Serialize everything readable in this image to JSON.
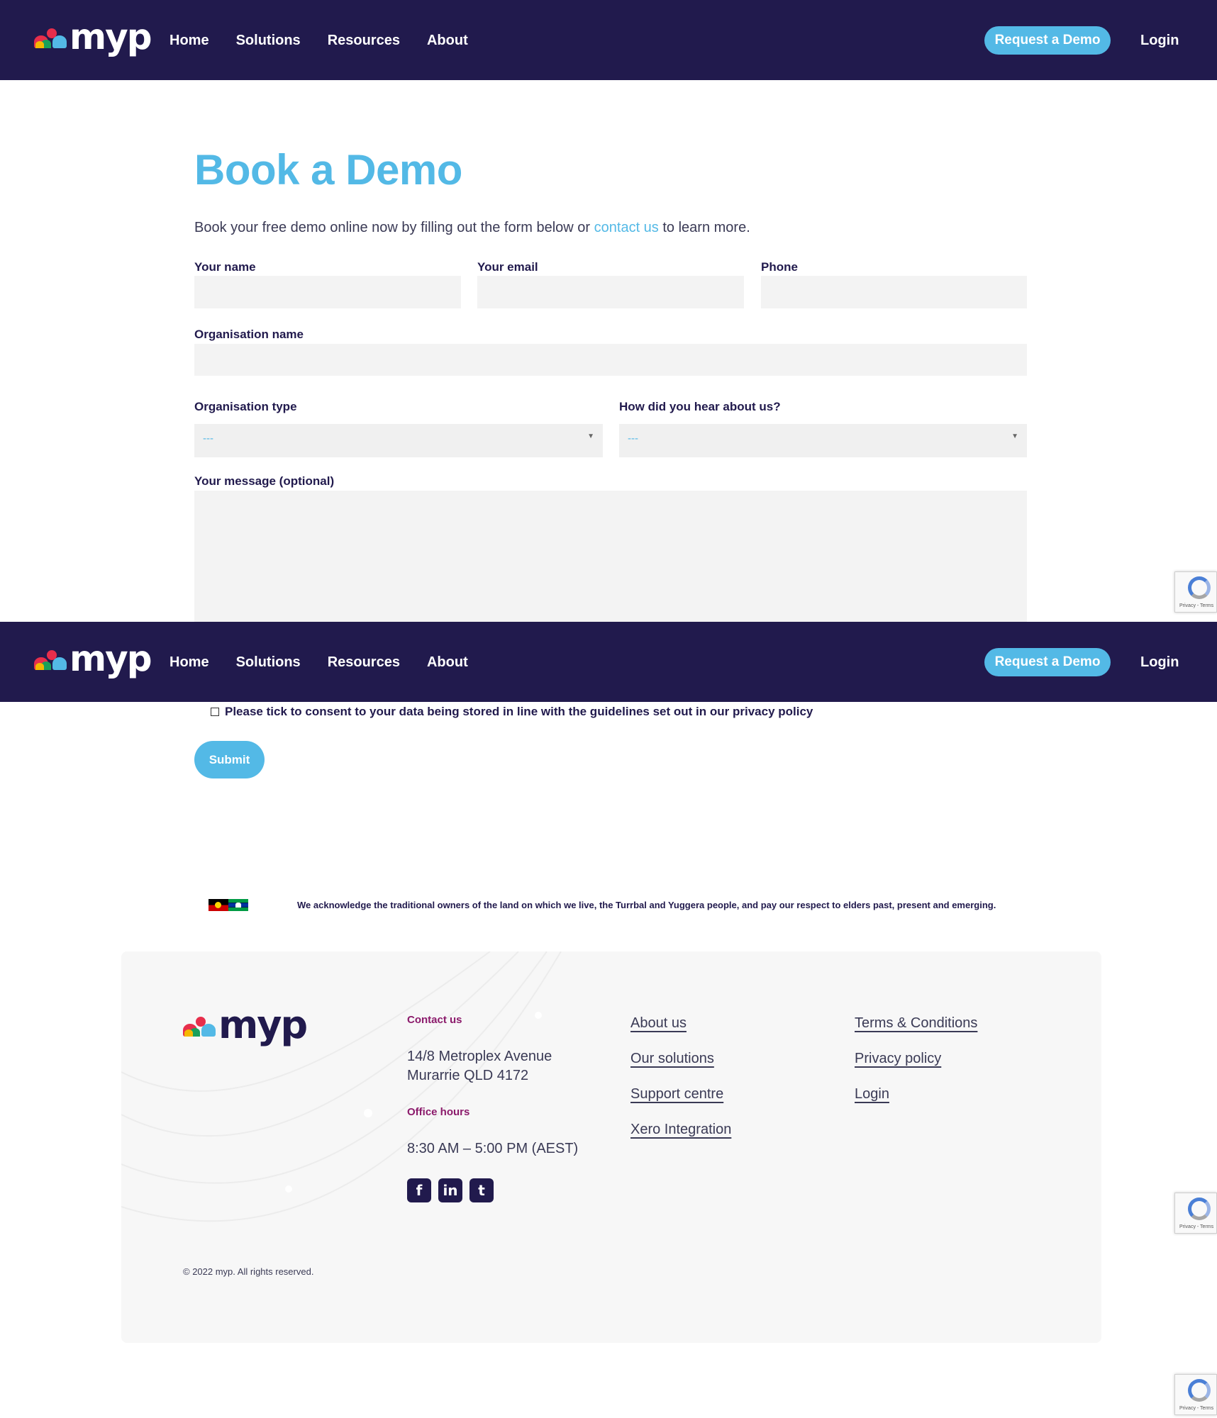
{
  "nav": {
    "logo_text": "myp",
    "links": [
      "Home",
      "Solutions",
      "Resources",
      "About"
    ],
    "demo_button": "Request a Demo",
    "login": "Login"
  },
  "form": {
    "title": "Book a Demo",
    "intro_before": "Book your free demo online now by filling out the form below or ",
    "intro_link": "contact us",
    "intro_after": " to learn more.",
    "name_label": "Your name",
    "email_label": "Your email",
    "phone_label": "Phone",
    "org_name_label": "Organisation name",
    "org_type_label": "Organisation type",
    "org_type_value": "---",
    "hear_label": "How did you hear about us?",
    "hear_value": "---",
    "message_label": "Your message (optional)",
    "consent_text": "Please tick to consent to your data being stored in line with the guidelines set out in our privacy policy",
    "submit": "Submit"
  },
  "recaptcha_text": "Privacy - Terms",
  "acknowledgement": "We acknowledge the traditional owners of the land on which we live, the Turrbal and Yuggera people, and pay our respect to elders past, present and emerging.",
  "footer": {
    "logo_text": "myp",
    "contact_heading": "Contact us",
    "address_line1": "14/8 Metroplex Avenue",
    "address_line2": "Murarrie QLD 4172",
    "hours_heading": "Office hours",
    "hours": "8:30 AM – 5:00 PM (AEST)",
    "social": [
      "f",
      "in",
      "t"
    ],
    "links_col1": [
      "About us",
      "Our solutions",
      "Support centre",
      "Xero Integration"
    ],
    "links_col2": [
      "Terms & Conditions",
      "Privacy policy",
      "Login"
    ],
    "copyright": "© 2022 myp.  All rights reserved."
  },
  "colors": {
    "navy": "#211a4d",
    "accent_blue": "#53b9e6",
    "heading_purple": "#8b1a6b",
    "field_gray": "#f3f3f3"
  }
}
